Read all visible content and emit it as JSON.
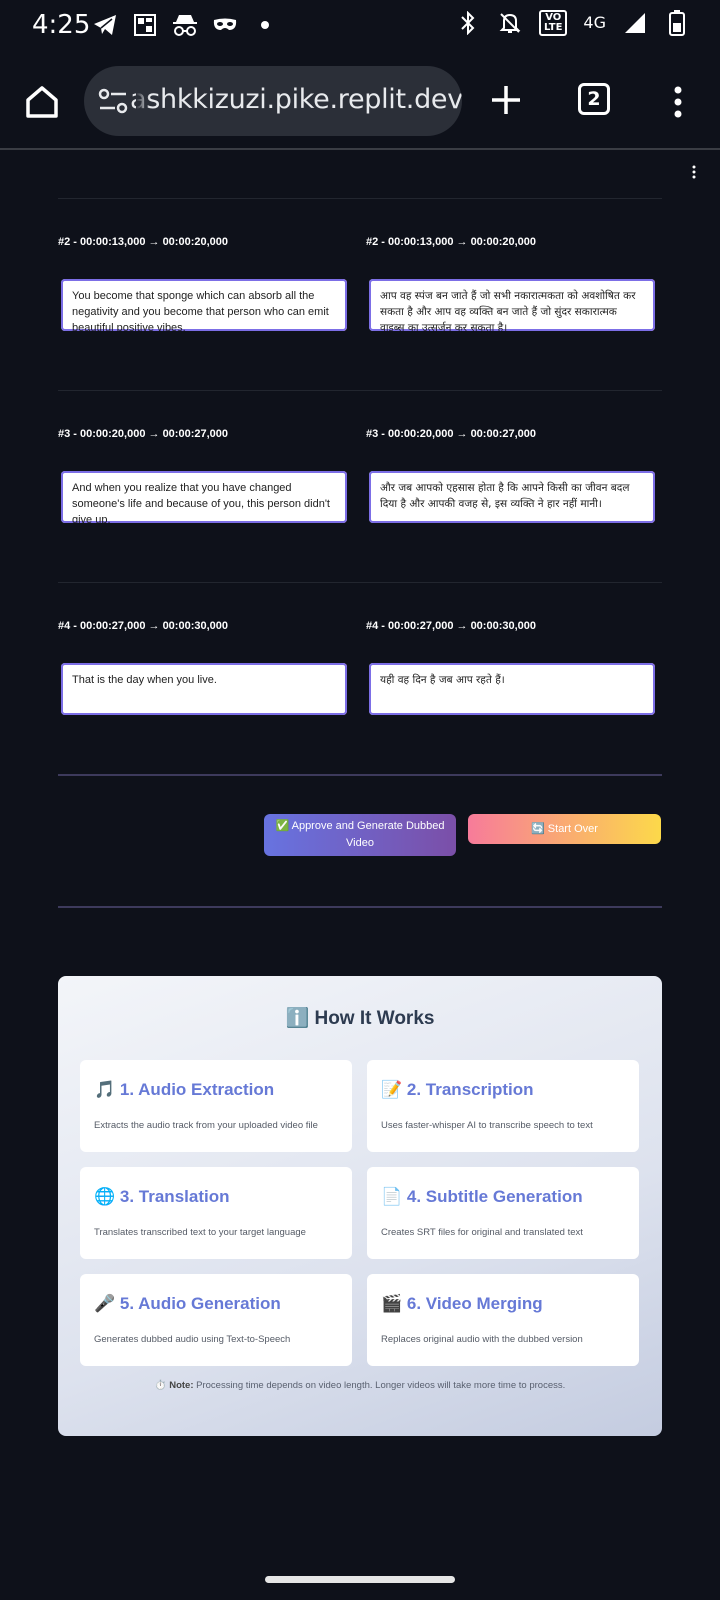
{
  "status_bar": {
    "time": "4:25",
    "volte": "VO\nLTE",
    "network": "4G"
  },
  "browser": {
    "url": "ashkkizuzi.pike.replit.dev",
    "tab_count": "2"
  },
  "segments": [
    {
      "label_original": "#2 - 00:00:13,000 → 00:00:20,000",
      "label_translated": "#2 - 00:00:13,000 → 00:00:20,000",
      "original_text": "You become that sponge which can absorb all the negativity and you become that person who can emit beautiful positive vibes.",
      "translated_text": "आप वह स्पंज बन जाते हैं जो सभी नकारात्मकता को अवशोषित कर सकता है और आप वह व्यक्ति बन जाते हैं जो सुंदर सकारात्मक वाइब्स का उत्सर्जन कर सकता है।"
    },
    {
      "label_original": "#3 - 00:00:20,000 → 00:00:27,000",
      "label_translated": "#3 - 00:00:20,000 → 00:00:27,000",
      "original_text": "And when you realize that you have changed someone's life and because of you, this person didn't give up.",
      "translated_text": "और जब आपको एहसास होता है कि आपने किसी का जीवन बदल दिया है और आपकी वजह से, इस व्यक्ति ने हार नहीं मानी।"
    },
    {
      "label_original": "#4 - 00:00:27,000 → 00:00:30,000",
      "label_translated": "#4 - 00:00:27,000 → 00:00:30,000",
      "original_text": "That is the day when you live.",
      "translated_text": "यही वह दिन है जब आप रहते हैं।"
    }
  ],
  "actions": {
    "approve_label": "✅ Approve and Generate Dubbed Video",
    "start_over_label": "🔄 Start Over"
  },
  "how_it_works": {
    "title": "ℹ️ How It Works",
    "steps": [
      {
        "title": "🎵 1. Audio Extraction",
        "desc": "Extracts the audio track from your uploaded video file"
      },
      {
        "title": "📝 2. Transcription",
        "desc": "Uses faster-whisper AI to transcribe speech to text"
      },
      {
        "title": "🌐 3. Translation",
        "desc": "Translates transcribed text to your target language"
      },
      {
        "title": "📄 4. Subtitle Generation",
        "desc": "Creates SRT files for original and translated text"
      },
      {
        "title": "🎤 5. Audio Generation",
        "desc": "Generates dubbed audio using Text-to-Speech"
      },
      {
        "title": "🎬 6. Video Merging",
        "desc": "Replaces original audio with the dubbed version"
      }
    ],
    "note_label": "⏱️ Note:",
    "note_text": "Processing time depends on video length. Longer videos will take more time to process."
  }
}
